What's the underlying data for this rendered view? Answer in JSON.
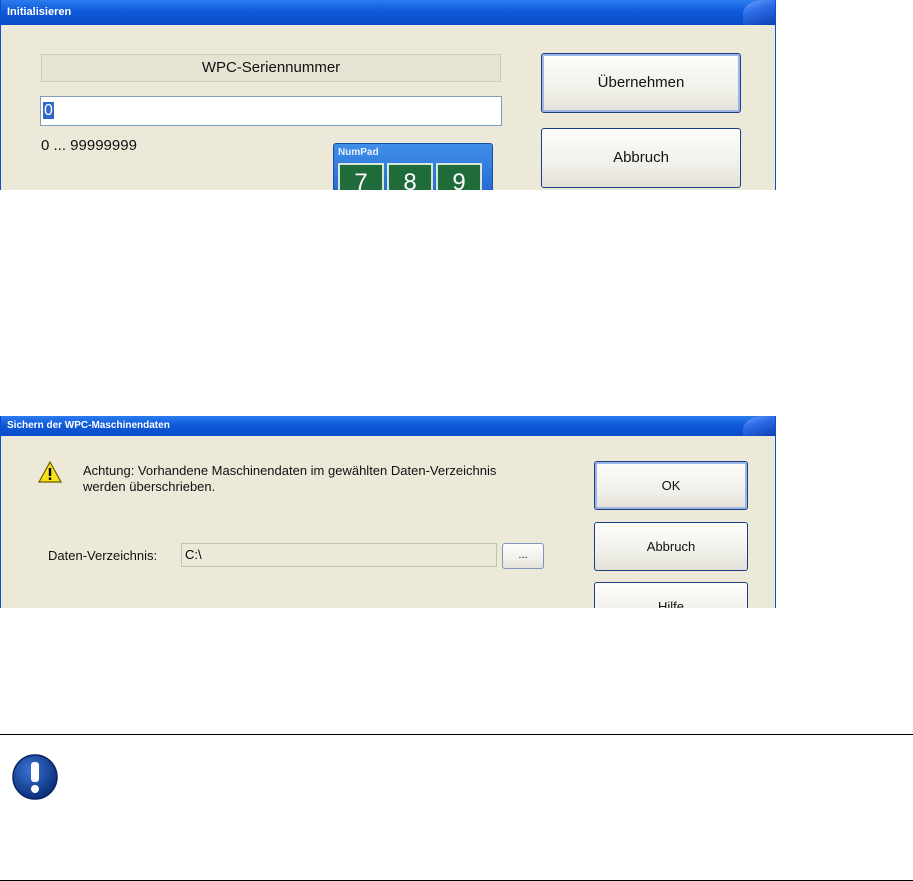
{
  "dialog1": {
    "title": "Initialisieren",
    "field_label": "WPC-Seriennummer",
    "input_value": "0",
    "range_text": "0 ... 99999999",
    "numpad": {
      "title": "NumPad",
      "keys": [
        "7",
        "8",
        "9"
      ]
    },
    "buttons": {
      "apply": "Übernehmen",
      "cancel": "Abbruch"
    }
  },
  "dialog2": {
    "title": "Sichern der WPC-Maschinendaten",
    "warning_line1": "Achtung: Vorhandene Maschinendaten im gewählten Daten-Verzeichnis",
    "warning_line2": "werden überschrieben.",
    "directory_label": "Daten-Verzeichnis:",
    "directory_value": "C:\\",
    "browse_label": "...",
    "buttons": {
      "ok": "OK",
      "cancel": "Abbruch",
      "help": "Hilfe"
    }
  },
  "icons": {
    "warning": "warning-icon",
    "notice": "exclamation-icon"
  },
  "colors": {
    "titlebar": "#0f5ad8",
    "dialog_bg": "#ece9d8",
    "numpad_key": "#1f6b3a"
  }
}
